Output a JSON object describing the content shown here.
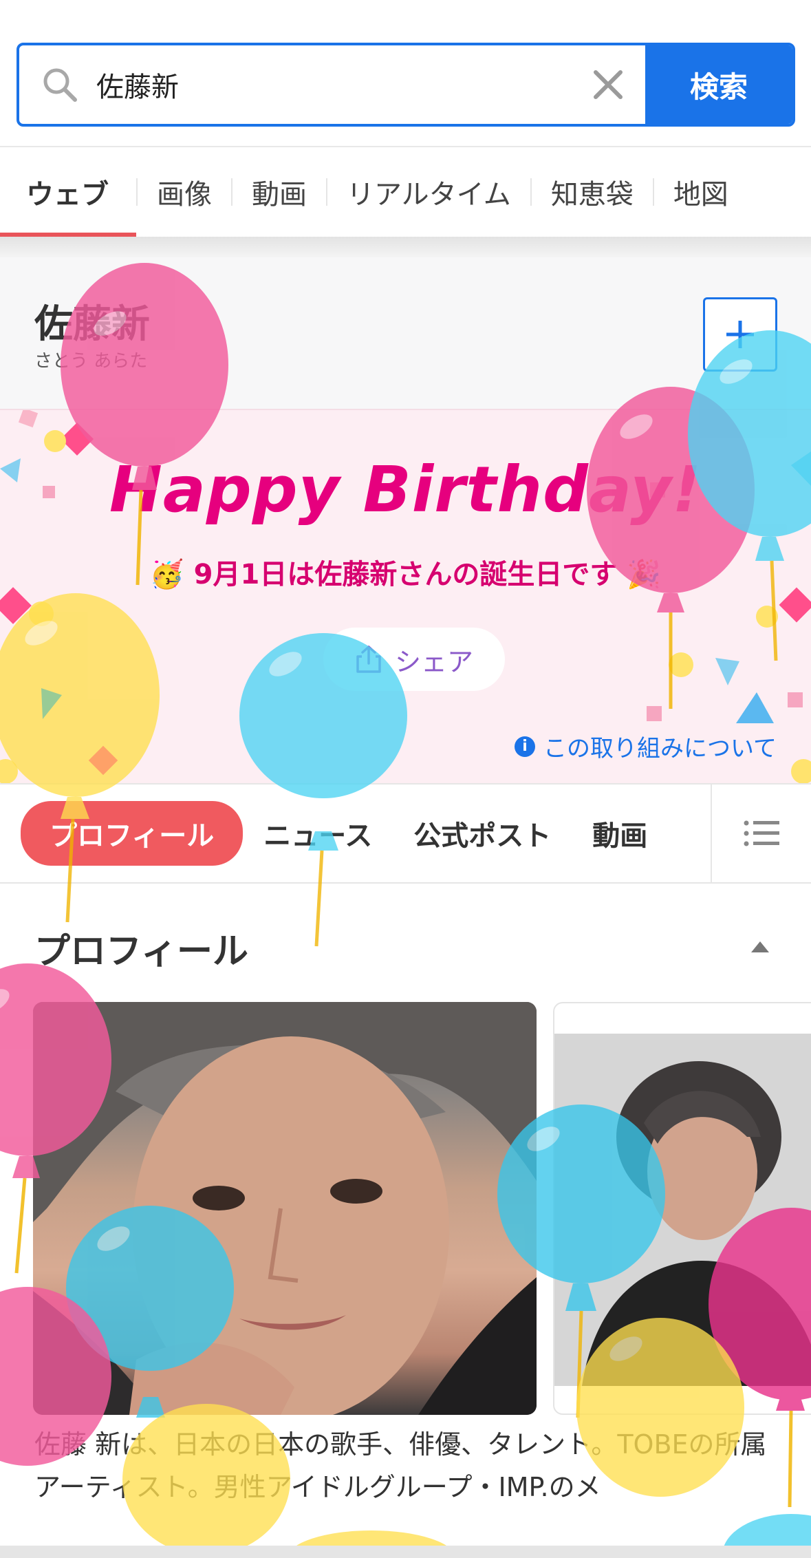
{
  "search": {
    "query": "佐藤新",
    "button_label": "検索"
  },
  "tabs": [
    {
      "label": "ウェブ",
      "active": true
    },
    {
      "label": "画像"
    },
    {
      "label": "動画"
    },
    {
      "label": "リアルタイム"
    },
    {
      "label": "知恵袋"
    },
    {
      "label": "地図"
    }
  ],
  "entity": {
    "name": "佐藤新",
    "reading": "さとう あらた"
  },
  "birthday": {
    "title": "Happy Birthday!",
    "subtitle": "9月1日は佐藤新さんの誕生日です",
    "share_label": "シェア",
    "about_label": "この取り組みについて"
  },
  "section_nav": [
    {
      "label": "プロフィール",
      "active": true
    },
    {
      "label": "ニュース"
    },
    {
      "label": "公式ポスト"
    },
    {
      "label": "動画"
    }
  ],
  "profile": {
    "heading": "プロフィール",
    "text": "佐藤 新は、日本の日本の歌手、俳優、タレント。TOBEの所属アーティスト。男性アイドルグループ・IMP.のメ"
  },
  "colors": {
    "accent": "#1a73e8",
    "tab_active": "#e9545a",
    "birthday_pink": "#e6007e",
    "nav_active": "#f05a5f"
  }
}
